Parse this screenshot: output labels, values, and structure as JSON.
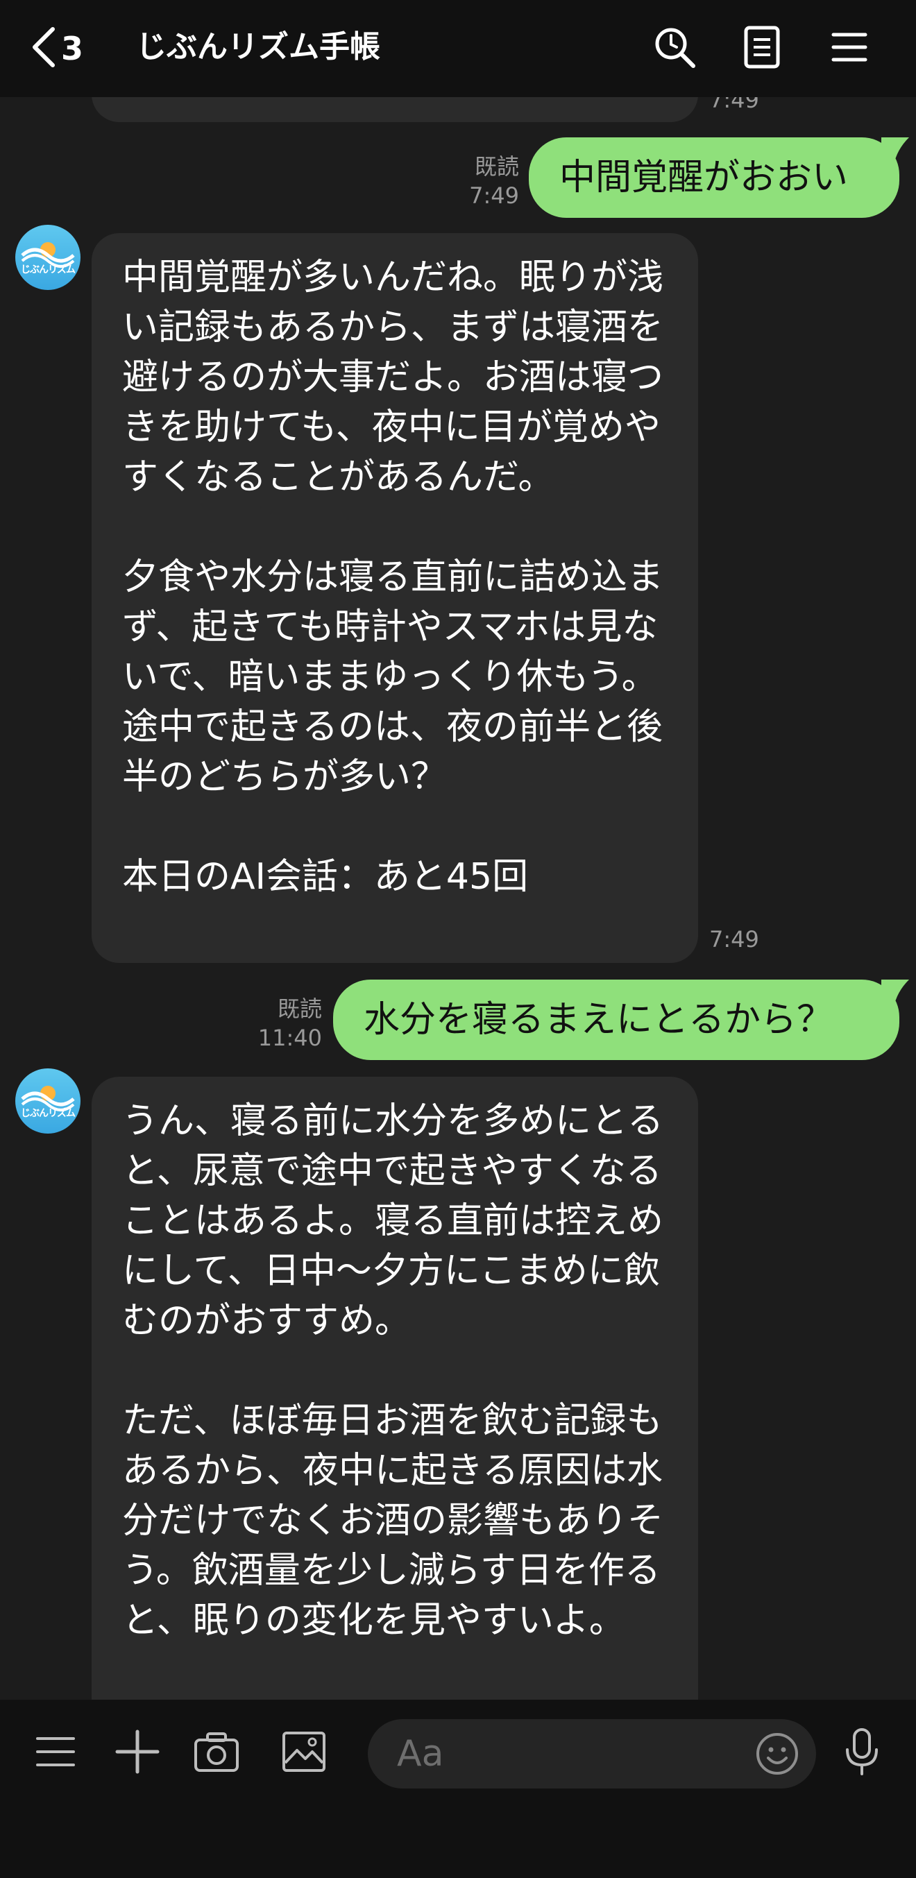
{
  "header": {
    "back_count": "3",
    "title": "じぶんリズム手帳"
  },
  "messages": [
    {
      "type": "outgoing",
      "text": "中間覚醒がおおい",
      "read_label": "既読",
      "time": "7:49"
    },
    {
      "type": "incoming",
      "text": "中間覚醒が多いんだね。眠りが浅い記録もあるから、まずは寝酒を避けるのが大事だよ。お酒は寝つきを助けても、夜中に目が覚めやすくなることがあるんだ。\n\n夕食や水分は寝る直前に詰め込まず、起きても時計やスマホは見ないで、暗いままゆっくり休もう。途中で起きるのは、夜の前半と後半のどちらが多い？\n\n本日のAI会話：あと45回",
      "time": "7:49"
    },
    {
      "type": "outgoing",
      "text": "水分を寝るまえにとるから？",
      "read_label": "既読",
      "time": "11:40"
    },
    {
      "type": "incoming",
      "text": "うん、寝る前に水分を多めにとると、尿意で途中で起きやすくなることはあるよ。寝る直前は控えめにして、日中〜夕方にこまめに飲むのがおすすめ。\n\nただ、ほぼ毎日お酒を飲む記録もあるから、夜中に起きる原因は水分だけでなくお酒の影響もありそう。飲酒量を少し減らす日を作ると、眠りの変化を見やすいよ。"
    }
  ],
  "partial_previous_time": "7:49",
  "avatar_label": "じぶんリズム",
  "input": {
    "placeholder": "Aa"
  },
  "icons": {
    "back": "chevron-left-icon",
    "search": "search-icon",
    "notes": "note-icon",
    "menu": "hamburger-menu-icon",
    "bar_menu": "hamburger-menu-icon",
    "add": "plus-icon",
    "camera": "camera-icon",
    "image": "image-icon",
    "emoji": "emoji-icon",
    "mic": "microphone-icon"
  },
  "colors": {
    "header_bg": "#111111",
    "chat_bg": "#1c1c1c",
    "incoming_bubble": "#2b2b2b",
    "outgoing_bubble": "#8fe07b",
    "meta_text": "#9a9a9a"
  }
}
